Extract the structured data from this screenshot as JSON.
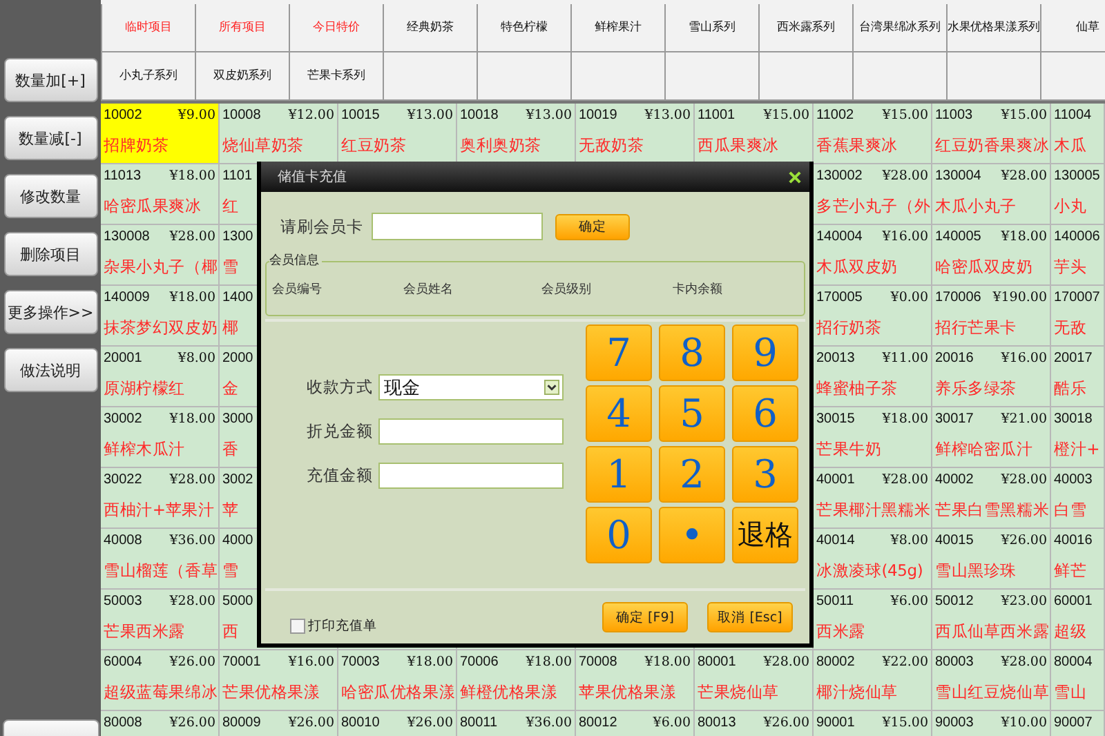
{
  "sidebar": {
    "buttons": [
      "数量加[+]",
      "数量减[-]",
      "修改数量",
      "删除项目",
      "更多操作>>",
      "做法说明"
    ]
  },
  "tabs": {
    "rows": [
      [
        {
          "label": "临时项目",
          "kind": "special"
        },
        {
          "label": "所有项目",
          "kind": "special"
        },
        {
          "label": "今日特价",
          "kind": "special"
        },
        {
          "label": "经典奶茶",
          "kind": "category"
        },
        {
          "label": "特色柠檬",
          "kind": "category"
        },
        {
          "label": "鲜榨果汁",
          "kind": "category"
        },
        {
          "label": "雪山系列",
          "kind": "category"
        },
        {
          "label": "西米露系列",
          "kind": "category"
        },
        {
          "label": "台湾果绵冰系列",
          "kind": "category"
        },
        {
          "label": "水果优格果漾系列",
          "kind": "category"
        },
        {
          "label": "仙草",
          "kind": "category"
        }
      ],
      [
        {
          "label": "小丸子系列",
          "kind": "category"
        },
        {
          "label": "双皮奶系列",
          "kind": "category"
        },
        {
          "label": "芒果卡系列",
          "kind": "category"
        }
      ]
    ]
  },
  "grid": {
    "rows": [
      [
        {
          "code": "10002",
          "price": "¥9.00",
          "name": "招牌奶茶",
          "selected": true
        },
        {
          "code": "10008",
          "price": "¥12.00",
          "name": "烧仙草奶茶",
          "selected": false
        },
        {
          "code": "10015",
          "price": "¥13.00",
          "name": "红豆奶茶",
          "selected": false
        },
        {
          "code": "10018",
          "price": "¥13.00",
          "name": "奥利奥奶茶",
          "selected": false
        },
        {
          "code": "10019",
          "price": "¥13.00",
          "name": "无敌奶茶",
          "selected": false
        },
        {
          "code": "11001",
          "price": "¥15.00",
          "name": "西瓜果爽冰",
          "selected": false
        },
        {
          "code": "11002",
          "price": "¥15.00",
          "name": "香蕉果爽冰",
          "selected": false
        },
        {
          "code": "11003",
          "price": "¥15.00",
          "name": "红豆奶香果爽冰",
          "selected": false
        },
        {
          "code": "11004",
          "name": "木瓜",
          "selected": false
        }
      ],
      [
        {
          "code": "11013",
          "price": "¥18.00",
          "name": "哈密瓜果爽冰",
          "selected": false
        },
        {
          "code": "1101",
          "name": "红",
          "selected": false
        },
        null,
        null,
        null,
        null,
        {
          "code": "130002",
          "price": "¥28.00",
          "name": "多芒小丸子（外",
          "selected": false
        },
        {
          "code": "130004",
          "price": "¥28.00",
          "name": "木瓜小丸子",
          "selected": false
        },
        {
          "code": "130005",
          "name": "小丸",
          "selected": false
        }
      ],
      [
        {
          "code": "130008",
          "price": "¥28.00",
          "name": "杂果小丸子（椰",
          "selected": false
        },
        {
          "code": "1300",
          "name": "雪",
          "selected": false
        },
        null,
        null,
        null,
        null,
        {
          "code": "140004",
          "price": "¥16.00",
          "name": "木瓜双皮奶",
          "selected": false
        },
        {
          "code": "140005",
          "price": "¥18.00",
          "name": "哈密瓜双皮奶",
          "selected": false
        },
        {
          "code": "140006",
          "name": "芋头",
          "selected": false
        }
      ],
      [
        {
          "code": "140009",
          "price": "¥18.00",
          "name": "抹茶梦幻双皮奶",
          "selected": false
        },
        {
          "code": "1400",
          "name": "椰",
          "selected": false
        },
        null,
        null,
        null,
        null,
        {
          "code": "170005",
          "price": "¥0.00",
          "name": "招行奶茶",
          "selected": false
        },
        {
          "code": "170006",
          "price": "¥190.00",
          "name": "招行芒果卡",
          "selected": false
        },
        {
          "code": "170007",
          "name": "无敌",
          "selected": false
        }
      ],
      [
        {
          "code": "20001",
          "price": "¥8.00",
          "name": "原湖柠檬红",
          "selected": false
        },
        {
          "code": "2000",
          "name": "金",
          "selected": false
        },
        null,
        null,
        null,
        null,
        {
          "code": "20013",
          "price": "¥11.00",
          "name": "蜂蜜柚子茶",
          "selected": false
        },
        {
          "code": "20016",
          "price": "¥16.00",
          "name": "养乐多绿茶",
          "selected": false
        },
        {
          "code": "20017",
          "name": "酷乐",
          "selected": false
        }
      ],
      [
        {
          "code": "30002",
          "price": "¥18.00",
          "name": "鲜榨木瓜汁",
          "selected": false
        },
        {
          "code": "3000",
          "name": "香",
          "selected": false
        },
        null,
        null,
        null,
        null,
        {
          "code": "30015",
          "price": "¥18.00",
          "name": "芒果牛奶",
          "selected": false
        },
        {
          "code": "30017",
          "price": "¥21.00",
          "name": "鲜榨哈密瓜汁",
          "selected": false
        },
        {
          "code": "30018",
          "name": "橙汁+",
          "selected": false
        }
      ],
      [
        {
          "code": "30022",
          "price": "¥28.00",
          "name": "西柚汁+苹果汁",
          "selected": false
        },
        {
          "code": "3002",
          "name": "苹",
          "selected": false
        },
        null,
        null,
        null,
        null,
        {
          "code": "40001",
          "price": "¥28.00",
          "name": "芒果椰汁黑糯米",
          "selected": false
        },
        {
          "code": "40002",
          "price": "¥28.00",
          "name": "芒果白雪黑糯米",
          "selected": false
        },
        {
          "code": "40003",
          "name": "白雪",
          "selected": false
        }
      ],
      [
        {
          "code": "40008",
          "price": "¥36.00",
          "name": "雪山榴莲（香草",
          "selected": false
        },
        {
          "code": "4000",
          "name": "雪",
          "selected": false
        },
        null,
        null,
        null,
        null,
        {
          "code": "40014",
          "price": "¥8.00",
          "name": "冰激凌球(45g)",
          "selected": false
        },
        {
          "code": "40015",
          "price": "¥26.00",
          "name": "雪山黑珍珠",
          "selected": false
        },
        {
          "code": "40016",
          "name": "鲜芒",
          "selected": false
        }
      ],
      [
        {
          "code": "50003",
          "price": "¥28.00",
          "name": "芒果西米露",
          "selected": false
        },
        {
          "code": "5000",
          "name": "西",
          "selected": false
        },
        null,
        null,
        null,
        null,
        {
          "code": "50011",
          "price": "¥6.00",
          "name": "西米露",
          "selected": false
        },
        {
          "code": "50012",
          "price": "¥23.00",
          "name": "西瓜仙草西米露",
          "selected": false
        },
        {
          "code": "60001",
          "name": "超级",
          "selected": false
        }
      ],
      [
        {
          "code": "60004",
          "price": "¥26.00",
          "name": "超级蓝莓果绵冰",
          "selected": false
        },
        {
          "code": "70001",
          "price": "¥16.00",
          "name": "芒果优格果漾",
          "selected": false
        },
        {
          "code": "70003",
          "price": "¥18.00",
          "name": "哈密瓜优格果漾",
          "selected": false
        },
        {
          "code": "70006",
          "price": "¥18.00",
          "name": "鲜橙优格果漾",
          "selected": false
        },
        {
          "code": "70008",
          "price": "¥18.00",
          "name": "苹果优格果漾",
          "selected": false
        },
        {
          "code": "80001",
          "price": "¥28.00",
          "name": "芒果烧仙草",
          "selected": false
        },
        {
          "code": "80002",
          "price": "¥22.00",
          "name": "椰汁烧仙草",
          "selected": false
        },
        {
          "code": "80003",
          "price": "¥28.00",
          "name": "雪山红豆烧仙草",
          "selected": false
        },
        {
          "code": "80004",
          "name": "雪山",
          "selected": false
        }
      ],
      [
        {
          "code": "80008",
          "price": "¥26.00",
          "selected": false
        },
        {
          "code": "80009",
          "price": "¥26.00",
          "selected": false
        },
        {
          "code": "80010",
          "price": "¥26.00",
          "selected": false
        },
        {
          "code": "80011",
          "price": "¥36.00",
          "selected": false
        },
        {
          "code": "80012",
          "price": "¥6.00",
          "selected": false
        },
        {
          "code": "80013",
          "price": "¥26.00",
          "selected": false
        },
        {
          "code": "90001",
          "price": "¥15.00",
          "selected": false
        },
        {
          "code": "90003",
          "price": "¥10.00",
          "selected": false
        },
        {
          "code": "90007",
          "selected": false
        }
      ]
    ]
  },
  "dialog": {
    "title": "储值卡充值",
    "card_label": "请刷会员卡",
    "card_button": "确定",
    "member_info": {
      "legend": "会员信息",
      "fields": [
        "会员编号",
        "会员姓名",
        "会员级别",
        "卡内余额"
      ]
    },
    "form": [
      {
        "label": "收款方式",
        "kind": "select",
        "value": "现金"
      },
      {
        "label": "折兑金额",
        "kind": "input"
      },
      {
        "label": "充值金额",
        "kind": "input"
      }
    ],
    "keypad": [
      {
        "label": "7",
        "kind": "digit"
      },
      {
        "label": "8",
        "kind": "digit"
      },
      {
        "label": "9",
        "kind": "digit"
      },
      {
        "label": "4",
        "kind": "digit"
      },
      {
        "label": "5",
        "kind": "digit"
      },
      {
        "label": "6",
        "kind": "digit"
      },
      {
        "label": "1",
        "kind": "digit"
      },
      {
        "label": "2",
        "kind": "digit"
      },
      {
        "label": "3",
        "kind": "digit"
      },
      {
        "label": "0",
        "kind": "digit"
      },
      {
        "label": "•",
        "kind": "digit"
      },
      {
        "label": "退格",
        "kind": "action"
      }
    ],
    "print_option": {
      "label": "打印充值单",
      "checked": false
    },
    "buttons": [
      "确定 [F9]",
      "取消 [Esc]"
    ]
  }
}
